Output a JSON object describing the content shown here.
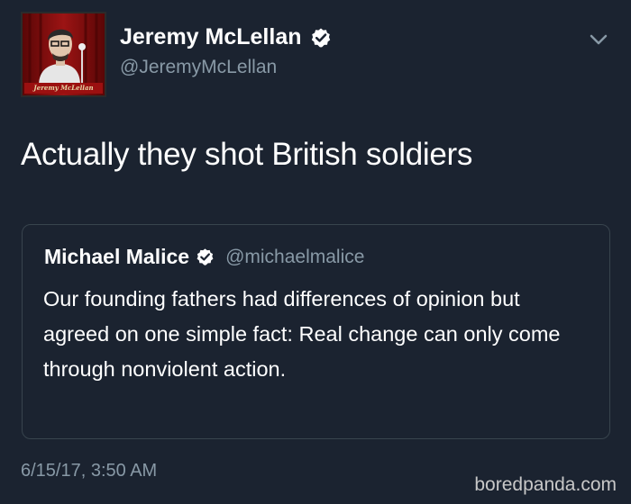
{
  "author": {
    "display_name": "Jeremy McLellan",
    "handle": "@JeremyMcLellan",
    "verified": true,
    "avatar_caption": "Jeremy McLellan"
  },
  "tweet": {
    "text": "Actually they shot British soldiers",
    "timestamp": "6/15/17, 3:50 AM"
  },
  "quoted_tweet": {
    "display_name": "Michael Malice",
    "handle": "@michaelmalice",
    "verified": true,
    "text": "Our founding fathers had differences of opinion but agreed on one simple fact: Real change can only come through nonviolent action."
  },
  "watermark": "boredpanda.com",
  "icons": {
    "verified": "verified-badge-icon",
    "menu": "chevron-down-icon"
  },
  "colors": {
    "background": "#1b2330",
    "secondary_text": "#8899a6",
    "border": "#38444d"
  }
}
